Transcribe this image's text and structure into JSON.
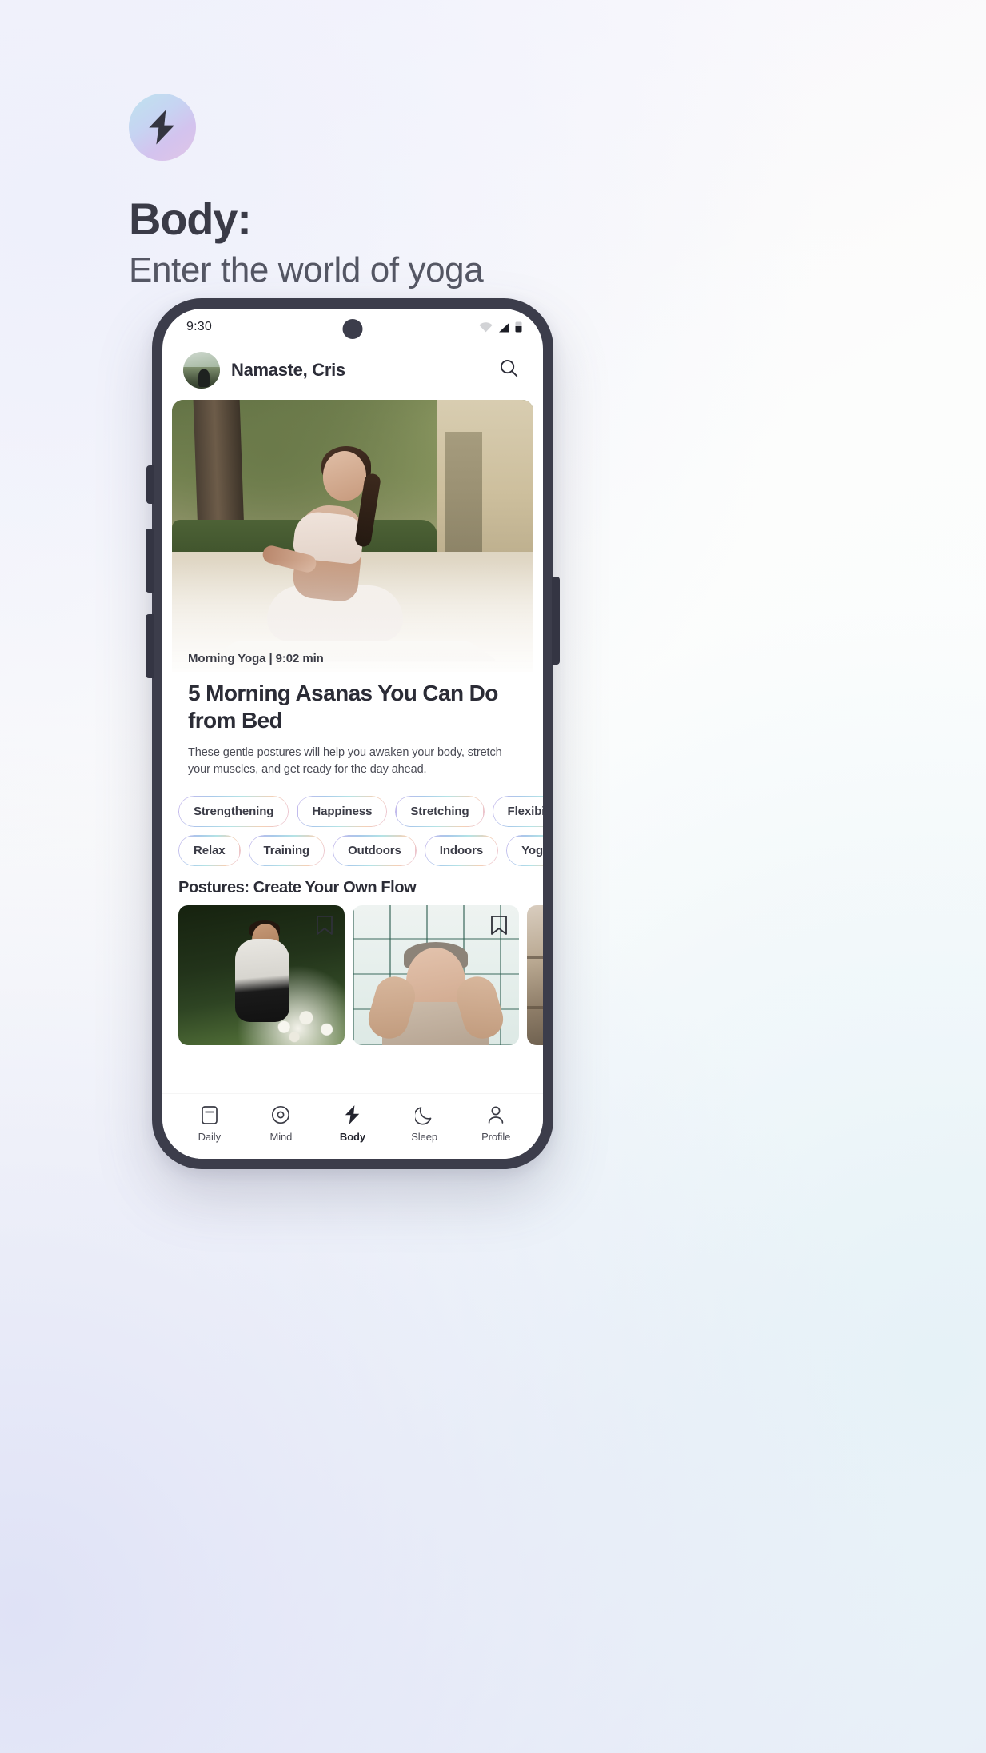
{
  "promo": {
    "logo_icon": "lightning-bolt-icon",
    "title": "Body:",
    "subtitle": "Enter the world of yoga",
    "accent_gradient_from": "#bfe3ee",
    "accent_gradient_to": "#e0c4e6"
  },
  "phone": {
    "status_bar": {
      "time": "9:30",
      "wifi_icon": "wifi-icon",
      "signal_icon": "cellular-signal-icon",
      "battery_icon": "battery-icon"
    },
    "app_header": {
      "avatar_name": "user-avatar",
      "greeting": "Namaste, Cris",
      "search_icon": "search-icon"
    },
    "hero": {
      "meta": "Morning Yoga | 9:02 min",
      "title": "5 Morning Asanas You Can Do from Bed",
      "description": "These gentle postures will help you awaken your body, stretch your muscles, and get ready for the day ahead."
    },
    "chips": {
      "row1": [
        "Strengthening",
        "Happiness",
        "Stretching",
        "Flexibility"
      ],
      "row2": [
        "Relax",
        "Training",
        "Outdoors",
        "Indoors",
        "Yoga"
      ]
    },
    "postures": {
      "section_title": "Postures: Create Your Own Flow",
      "cards": [
        {
          "name": "posture-card-meditation",
          "bookmark_icon": "bookmark-icon"
        },
        {
          "name": "posture-card-temple-press",
          "bookmark_icon": "bookmark-icon"
        },
        {
          "name": "posture-card-indoor",
          "bookmark_icon": "bookmark-icon"
        }
      ]
    },
    "bottom_nav": [
      {
        "label": "Daily",
        "icon": "calendar-icon",
        "active": false
      },
      {
        "label": "Mind",
        "icon": "target-circle-icon",
        "active": false
      },
      {
        "label": "Body",
        "icon": "lightning-bolt-icon",
        "active": true
      },
      {
        "label": "Sleep",
        "icon": "moon-icon",
        "active": false
      },
      {
        "label": "Profile",
        "icon": "person-icon",
        "active": false
      }
    ]
  }
}
